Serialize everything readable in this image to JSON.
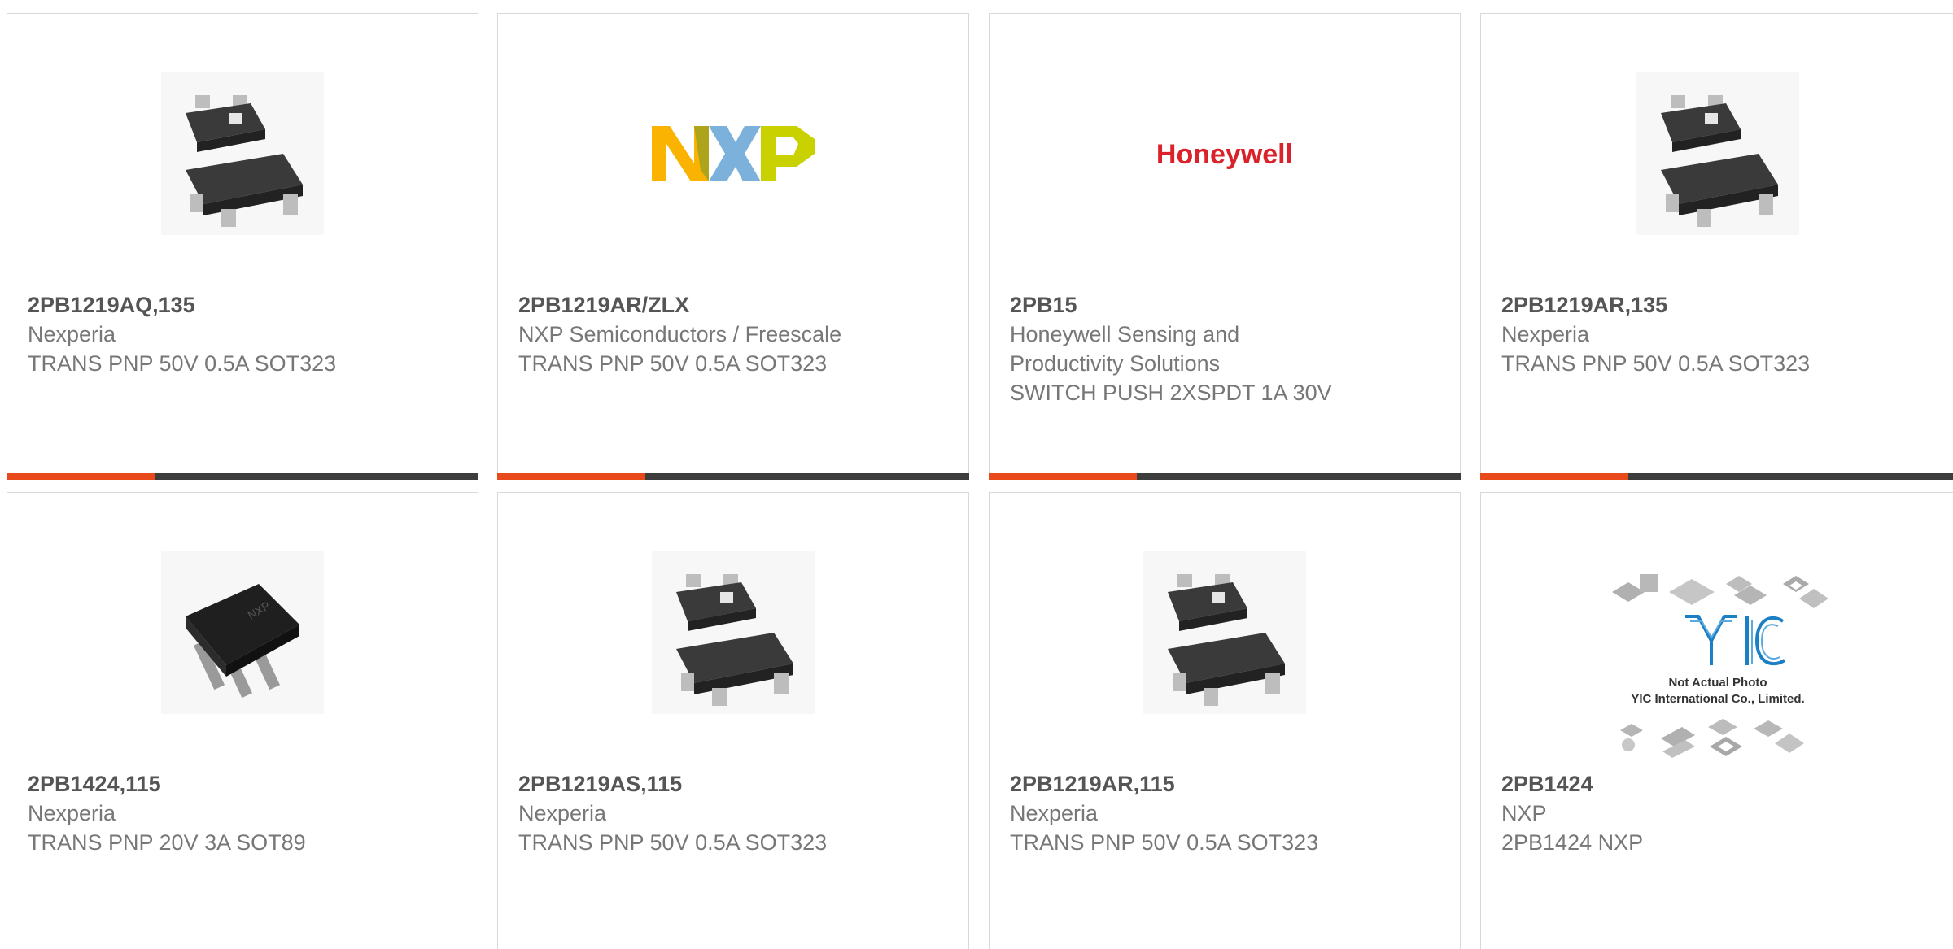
{
  "colors": {
    "accent": "#e84a1b",
    "bar": "#3d3d3d",
    "part_number": "#555555",
    "text": "#777777",
    "border": "#d9d9d9"
  },
  "products": [
    {
      "part_number": "2PB1219AQ,135",
      "manufacturer": "Nexperia",
      "description": "TRANS PNP 50V 0.5A SOT323",
      "image": "sot323-package-photo"
    },
    {
      "part_number": "2PB1219AR/ZLX",
      "manufacturer": "NXP Semiconductors / Freescale",
      "description": "TRANS PNP 50V 0.5A SOT323",
      "image": "nxp-logo",
      "logo_letters": [
        "N",
        "X",
        "P"
      ]
    },
    {
      "part_number": "2PB15",
      "manufacturer_line1": "Honeywell Sensing and",
      "manufacturer_line2": "Productivity Solutions",
      "description": "SWITCH PUSH 2XSPDT 1A 30V",
      "image": "honeywell-logo",
      "logo_text": "Honeywell"
    },
    {
      "part_number": "2PB1219AR,135",
      "manufacturer": "Nexperia",
      "description": "TRANS PNP 50V 0.5A SOT323",
      "image": "sot323-package-photo"
    },
    {
      "part_number": "2PB1424,115",
      "manufacturer": "Nexperia",
      "description": "TRANS PNP 20V 3A SOT89",
      "image": "sot89-package-photo"
    },
    {
      "part_number": "2PB1219AS,115",
      "manufacturer": "Nexperia",
      "description": "TRANS PNP 50V 0.5A SOT323",
      "image": "sot323-package-photo"
    },
    {
      "part_number": "2PB1219AR,115",
      "manufacturer": "Nexperia",
      "description": "TRANS PNP 50V 0.5A SOT323",
      "image": "sot323-package-photo"
    },
    {
      "part_number": "2PB1424",
      "manufacturer": "NXP",
      "description": "2PB1424 NXP",
      "image": "yic-placeholder-photo",
      "placeholder_logo": "YIC",
      "placeholder_line1": "Not Actual Photo",
      "placeholder_line2": "YIC International Co., Limited."
    }
  ]
}
